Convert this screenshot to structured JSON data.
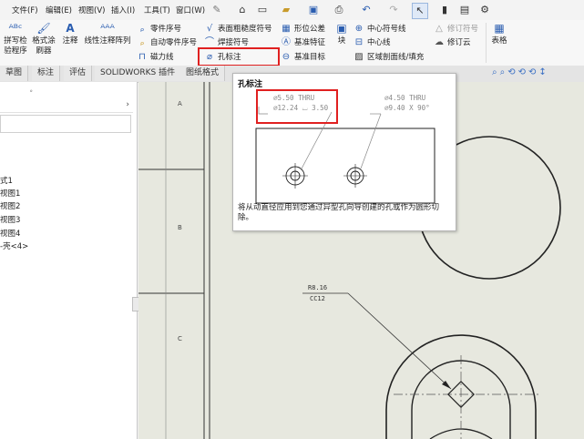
{
  "menu": {
    "file": "文件(F)",
    "edit": "编辑(E)",
    "view": "视图(V)",
    "insert": "插入(I)",
    "tools": "工具(T)",
    "window": "窗口(W)"
  },
  "ribbon": {
    "spell_check": [
      "拼写检",
      "验程序"
    ],
    "format_painter": [
      "格式涂",
      "刷器"
    ],
    "note": "注释",
    "linear_note_pattern": "线性注释阵列",
    "balloon": "零件序号",
    "auto_balloon": "自动零件序号",
    "magnetic_line": "磁力线",
    "surface_finish": "表面粗糙度符号",
    "weld_symbol": "焊接符号",
    "hole_callout": "孔标注",
    "gtol": "形位公差",
    "datum_feature": "基准特征",
    "datum_target": "基准目标",
    "block": "块",
    "center_mark": "中心符号线",
    "centerline": "中心线",
    "area_hatch": "区域剖面线/填充",
    "revision_symbol": "修订符号",
    "revision_cloud": "修订云",
    "table": "表格"
  },
  "tabs": [
    "草图",
    "标注",
    "评估",
    "SOLIDWORKS 插件",
    "图纸格式"
  ],
  "left_panel": {
    "items": [
      "式1",
      "视图1",
      "视图2",
      "视图3",
      "视图4",
      "-壳<4>"
    ]
  },
  "sheet_zones": [
    "A",
    "B",
    "C"
  ],
  "drawing": {
    "note_line1": "R8.16",
    "note_line2": "CC12"
  },
  "tooltip": {
    "title": "孔标注",
    "callout_a_line1": "⌀5.50 THRU",
    "callout_a_line2": "⌀12.24 ⌴ 3.50",
    "callout_b_line1": "⌀4.50 THRU",
    "callout_b_line2": "⌀9.40 X 90°",
    "description": "将从动直径应用到您通过异型孔向导创建的孔或作为圆形切除。"
  },
  "colors": {
    "highlight": "#e02020",
    "canvas": "#e7e8df",
    "icon_blue": "#2a5db0"
  }
}
